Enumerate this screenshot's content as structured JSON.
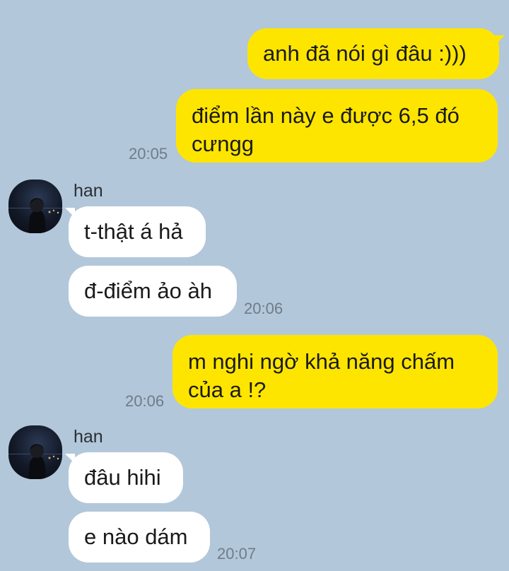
{
  "messages": [
    {
      "from": "me",
      "text": "anh đã nói gì đâu :)))"
    },
    {
      "from": "me",
      "text": "điểm lần này e được 6,5 đó cưngg",
      "time": "20:05"
    },
    {
      "from": "han",
      "sender": "han",
      "text": "t-thật á hả"
    },
    {
      "from": "han",
      "text": "đ-điểm ảo àh",
      "time": "20:06"
    },
    {
      "from": "me",
      "text": "m nghi ngờ khả năng chấm của a !?",
      "time": "20:06"
    },
    {
      "from": "han",
      "sender": "han",
      "text": "đâu hihi"
    },
    {
      "from": "han",
      "text": "e nào dám",
      "time": "20:07"
    }
  ],
  "colors": {
    "background": "#b2c7da",
    "my_bubble": "#fee500",
    "their_bubble": "#ffffff"
  },
  "icons": {
    "avatar": "profile-photo-icon"
  }
}
